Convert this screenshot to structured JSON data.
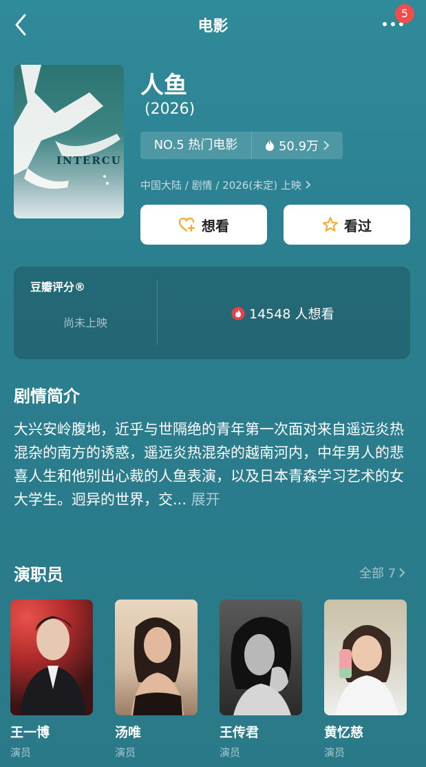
{
  "header": {
    "title": "电影",
    "back_icon": "chevron-left-icon",
    "more_icon": "more-dots-icon",
    "notification_count": "5"
  },
  "movie": {
    "title": "人鱼",
    "year": "(2026)",
    "poster_text": "INTERCU",
    "rank_label": "NO.5 热门电影",
    "heat": "50.9万",
    "meta": "中国大陆 / 剧情 / 2026(未定) 上映"
  },
  "actions": {
    "want_label": "想看",
    "seen_label": "看过"
  },
  "rating": {
    "label": "豆瓣评分®",
    "status": "尚未上映",
    "want_count": "14548 人想看"
  },
  "synopsis": {
    "title": "剧情简介",
    "text": "大兴安岭腹地，近乎与世隔绝的青年第一次面对来自遥远炎热混杂的南方的诱惑，遥远炎热混杂的越南河内，中年男人的悲喜人生和他别出心裁的人鱼表演，以及日本青森学习艺术的女大学生。迥异的世界，交...",
    "expand_label": "展开"
  },
  "cast": {
    "title": "演职员",
    "all_label": "全部 7",
    "members": [
      {
        "name": "王一博",
        "role": "演员"
      },
      {
        "name": "汤唯",
        "role": "演员"
      },
      {
        "name": "王传君",
        "role": "演员"
      },
      {
        "name": "黄忆慈",
        "role": "演员"
      }
    ]
  },
  "colors": {
    "background": "#2b7f8f",
    "badge": "#f04d4d",
    "accent_orange": "#f5a623",
    "flame_red": "#e8404a"
  }
}
